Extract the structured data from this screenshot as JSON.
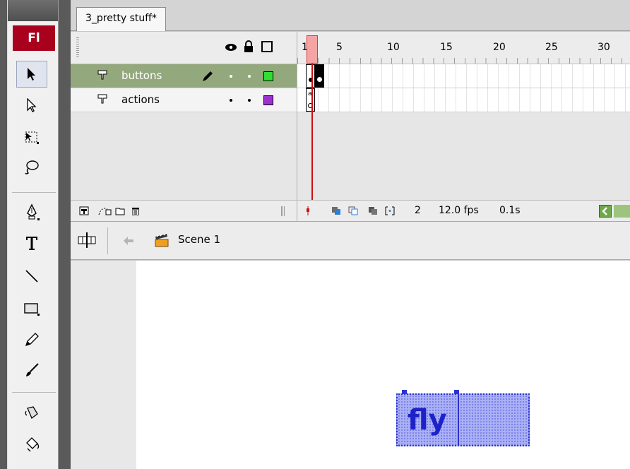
{
  "app": {
    "logo": "Fl"
  },
  "document_tab": {
    "label": "3_pretty stuff*"
  },
  "timeline": {
    "frame_numbers": [
      "1",
      "5",
      "10",
      "15",
      "20",
      "25",
      "30"
    ],
    "layers": [
      {
        "name": "buttons",
        "color": "#33dd33",
        "selected": true
      },
      {
        "name": "actions",
        "color": "#9933cc",
        "selected": false
      }
    ],
    "footer": {
      "current_frame": "2",
      "frame_rate": "12.0 fps",
      "elapsed_time": "0.1s"
    }
  },
  "editbar": {
    "scene": "Scene 1"
  },
  "stage": {
    "button_text": "fly"
  },
  "colors": {
    "logo_bg": "#a8001d",
    "selected_layer_bg": "#94a87d",
    "playhead": "#cc1111",
    "button_fill": "#aab0f5",
    "button_text": "#1d22c8"
  },
  "tools": [
    "selection-tool-icon",
    "subselection-tool-icon",
    "free-transform-tool-icon",
    "lasso-tool-icon",
    "pen-tool-icon",
    "text-tool-icon",
    "line-tool-icon",
    "rectangle-tool-icon",
    "pencil-tool-icon",
    "brush-tool-icon",
    "ink-bottle-tool-icon",
    "paint-bucket-tool-icon"
  ]
}
